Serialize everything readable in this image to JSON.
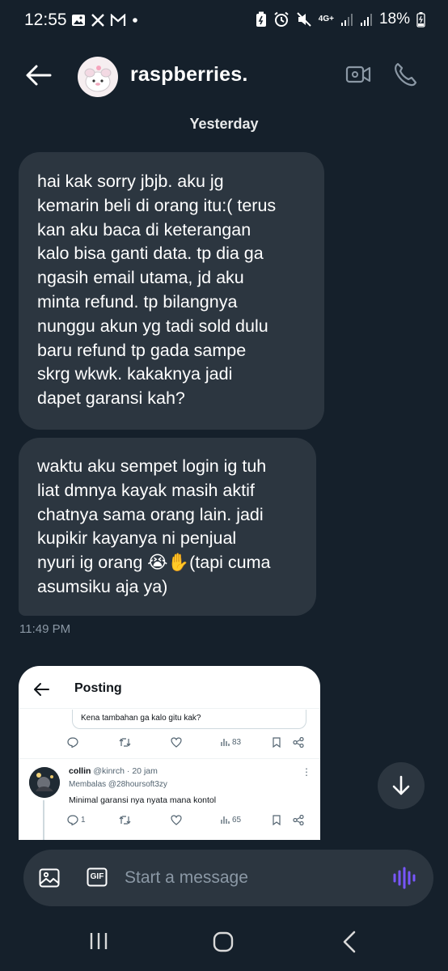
{
  "status_bar": {
    "time": "12:55",
    "network": "4G+",
    "battery": "18%",
    "left_icons": [
      "gallery-icon",
      "x-logo-icon",
      "gmail-icon",
      "dot-icon"
    ],
    "right_icons": [
      "battery-saver-icon",
      "alarm-icon",
      "mute-icon",
      "signal-icon",
      "signal-icon",
      "battery-icon"
    ]
  },
  "header": {
    "contact_name": "raspberries.",
    "icons": [
      "back-arrow-icon",
      "video-call-icon",
      "phone-call-icon"
    ]
  },
  "conversation": {
    "date_separator": "Yesterday",
    "messages": [
      {
        "lines": [
          "hai kak sorry jbjb. aku jg",
          "kemarin beli di orang itu:( terus",
          "kan aku baca di keterangan",
          "kalo bisa ganti data. tp dia ga",
          "ngasih email utama, jd aku",
          "minta refund. tp bilangnya",
          "nunggu akun yg tadi sold dulu",
          "baru refund tp gada sampe",
          "skrg wkwk. kakaknya jadi",
          "dapet garansi kah?"
        ]
      },
      {
        "lines": [
          "waktu aku sempet login ig tuh",
          "liat dmnya kayak masih aktif",
          "chatnya sama orang lain. jadi",
          "kupikir kayanya ni penjual",
          "nyuri ig orang 😭✋(tapi cuma",
          "asumsiku aja ya)"
        ]
      }
    ],
    "timestamp": "11:49 PM"
  },
  "shared_image": {
    "title": "Posting",
    "quoted_text": "Kena tambahan ga kalo gitu kak?",
    "post_views": "83",
    "reply": {
      "name": "collin",
      "handle": "@kinrch · 20 jam",
      "replying_to": "Membalas @28hoursoft3zy",
      "text": "Minimal garansi nya nyata mana kontol",
      "reply_count": "1",
      "views": "65"
    }
  },
  "composer": {
    "placeholder": "Start a message",
    "gif_label": "GIF"
  },
  "colors": {
    "background": "#15202b",
    "bubble": "#2c3640",
    "secondary_text": "#8b98a5",
    "voice_accent": "#7856ff"
  }
}
